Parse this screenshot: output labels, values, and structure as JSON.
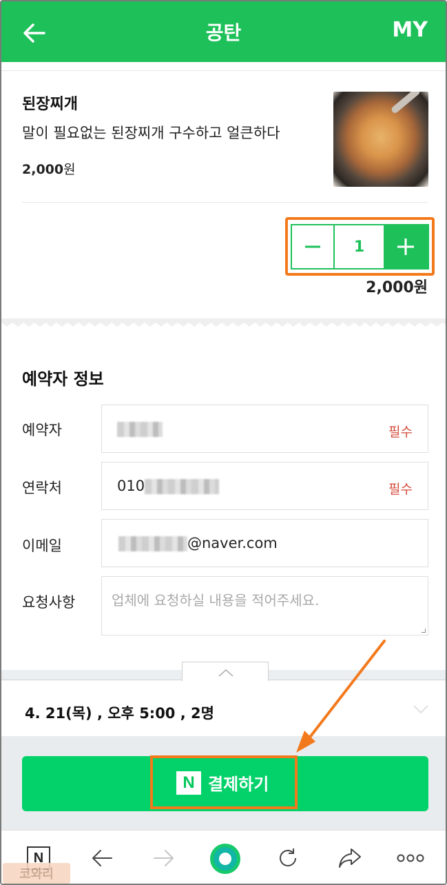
{
  "header": {
    "title": "공탄",
    "my_label": "MY"
  },
  "product": {
    "name": "된장찌개",
    "description": "말이 필요없는 된장찌개 구수하고 얼큰하다",
    "price_num": "2,000",
    "price_unit": "원",
    "quantity": "1",
    "subtotal": "2,000원"
  },
  "reservation": {
    "section_title": "예약자 정보",
    "fields": [
      {
        "label": "예약자",
        "value": "",
        "required": "필수"
      },
      {
        "label": "연락처",
        "value": "010",
        "required": "필수"
      },
      {
        "label": "이메일",
        "value": "@naver.com"
      },
      {
        "label": "요청사항",
        "placeholder": "업체에 요청하실 내용을 적어주세요."
      }
    ]
  },
  "summary": {
    "text": "4. 21(목) , 오후 5:00 , 2명"
  },
  "pay": {
    "logo": "N",
    "label": "결제하기"
  },
  "browser_bar": {
    "home_logo": "N",
    "icons": [
      "n-home-icon",
      "back-arrow-icon",
      "forward-arrow-icon",
      "green-dot-icon",
      "reload-icon",
      "share-icon",
      "more-icon"
    ]
  },
  "watermark": "코와리",
  "colors": {
    "brand_green": "#1ec05a",
    "pay_green": "#03d169",
    "highlight_orange": "#f27a1d",
    "required_red": "#d44a3a"
  }
}
